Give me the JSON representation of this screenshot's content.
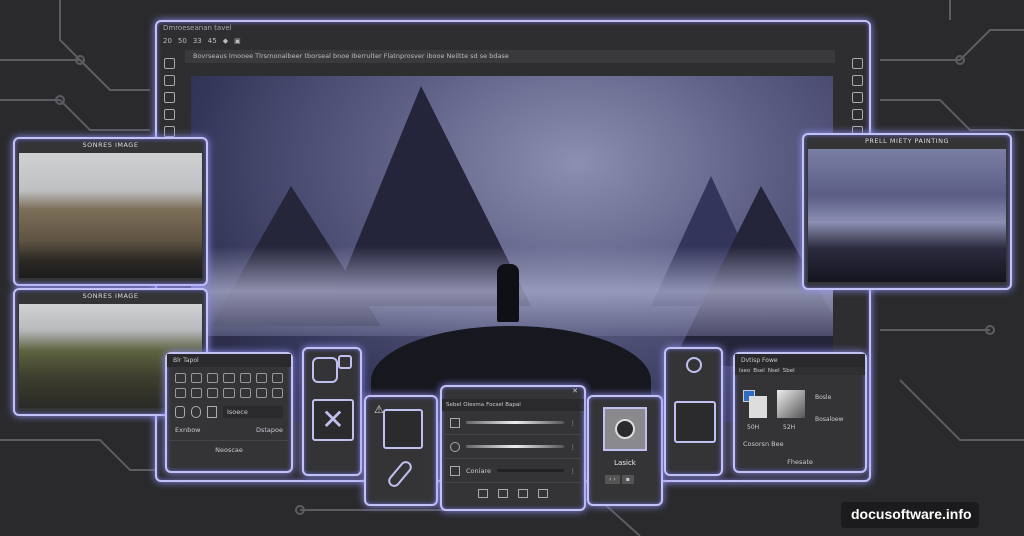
{
  "window": {
    "title": "Dmroeseanan tavel",
    "toolbar": [
      "20",
      "50",
      "33",
      "45",
      "◆",
      "▣"
    ],
    "options_text": "Bovrseaus Imooee Tlrsrnonalbeer tborseal bnoe Iberrulter Flatnprosver ibooe Neiltte sd se bdase"
  },
  "source_images": [
    {
      "label": "SONRES IMAGE"
    },
    {
      "label": "SONRES IMAGE"
    }
  ],
  "result_image": {
    "label": "PRELL MIETY PAINTING"
  },
  "tools_panel": {
    "tab": "Blr Tapol",
    "field": "Isoece",
    "left_label": "Exnbow",
    "mid_label": "Dstapoe",
    "bottom_label": "Neoscae"
  },
  "layers_panel": {
    "tabs": [
      "Sebel",
      "Olesma",
      "Focsel",
      "Bapal"
    ],
    "rows": [
      {
        "label": ""
      },
      {
        "label": ""
      },
      {
        "label": "Coniare"
      }
    ]
  },
  "lasso_panel": {
    "label": "Lasick",
    "buttons": [
      "‹ ›",
      "▪"
    ]
  },
  "color_panel": {
    "title": "Dvtisp Fowe",
    "tabs": [
      "Iseo",
      "Bsel",
      "Nsel",
      "Sbel"
    ],
    "values": [
      "50H",
      "52H"
    ],
    "btn1": "Bosle",
    "btn2": "Bosaloew",
    "row_label": "Cosorsn Bee",
    "bottom_label": "Fhesate",
    "fg_color": "#2f6bc4"
  },
  "watermark": "docusoftware.info"
}
